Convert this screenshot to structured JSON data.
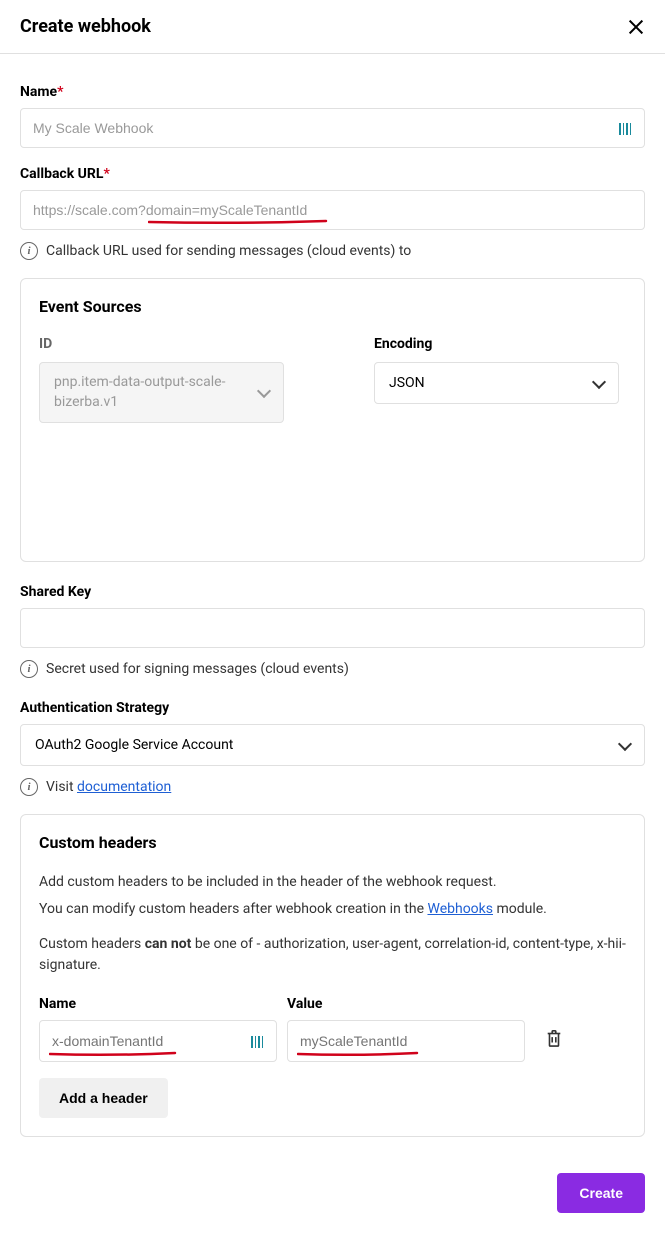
{
  "header": {
    "title": "Create webhook"
  },
  "name": {
    "label": "Name",
    "placeholder": "My Scale Webhook"
  },
  "callback": {
    "label": "Callback URL",
    "placeholder": "https://scale.com?domain=myScaleTenantId",
    "helper": "Callback URL used for sending messages (cloud events) to"
  },
  "eventSources": {
    "title": "Event Sources",
    "idLabel": "ID",
    "idValue": "pnp.item-data-output-scale-bizerba.v1",
    "encodingLabel": "Encoding",
    "encodingValue": "JSON"
  },
  "sharedKey": {
    "label": "Shared Key",
    "helper": "Secret used for signing messages (cloud events)"
  },
  "auth": {
    "label": "Authentication Strategy",
    "value": "OAuth2 Google Service Account",
    "helperPrefix": "Visit ",
    "helperLink": "documentation"
  },
  "customHeaders": {
    "title": "Custom headers",
    "desc1": "Add custom headers to be included in the header of the webhook request.",
    "desc2a": "You can modify custom headers after webhook creation in the ",
    "desc2Link": "Webhooks",
    "desc2b": " module.",
    "desc3a": "Custom headers ",
    "desc3b": "can not",
    "desc3c": " be one of - authorization, user-agent, correlation-id, content-type, x-hii-signature.",
    "nameLabel": "Name",
    "valueLabel": "Value",
    "namePlaceholder": "x-domainTenantId",
    "valuePlaceholder": "myScaleTenantId",
    "addBtn": "Add a header"
  },
  "footer": {
    "create": "Create"
  }
}
